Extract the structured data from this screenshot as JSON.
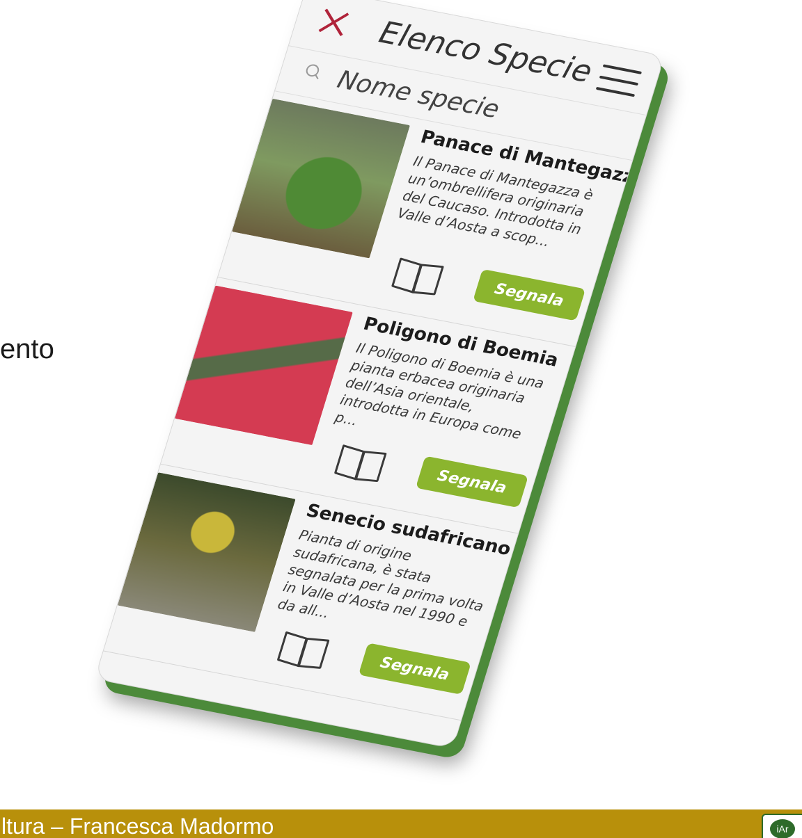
{
  "slide": {
    "left_fragment": "ento",
    "footer_text": "ltura – Francesca Madormo",
    "logo_text": "iAr"
  },
  "app": {
    "title": "Elenco Specie",
    "search_placeholder": "Nome specie",
    "close_icon": "close-icon",
    "menu_icon": "menu-icon",
    "accent_color": "#8bb52e",
    "close_color": "#b0233a"
  },
  "species": [
    {
      "name": "Panace di Mantegazza",
      "description": "Il Panace di Mantegazza è un’ombrellifera originaria del Caucaso. Introdotta in Valle d’Aosta a scop...",
      "button": "Segnala"
    },
    {
      "name": "Poligono di Boemia",
      "description": "Il Poligono di Boemia è una pianta erbacea originaria dell’Asia orientale, introdotta in Europa come p...",
      "button": "Segnala"
    },
    {
      "name": "Senecio sudafricano",
      "description": "Pianta di origine sudafricana, è stata segnalata per la prima volta in Valle d’Aosta nel 1990 e da all...",
      "button": "Segnala"
    }
  ]
}
